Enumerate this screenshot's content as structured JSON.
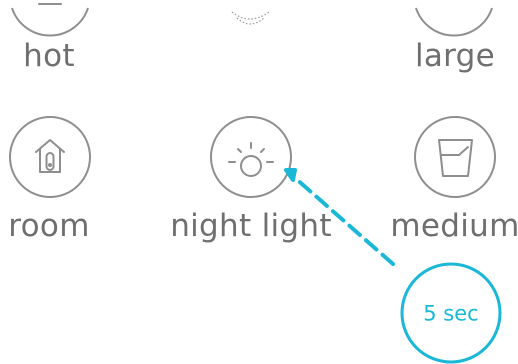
{
  "options": {
    "top_left": {
      "label": "hot",
      "icon": "dial-icon"
    },
    "top_center": {
      "label": "",
      "icon": "dimmed-sun-icon"
    },
    "top_right": {
      "label": "large",
      "icon": "cup-icon"
    },
    "room": {
      "label": "room",
      "icon": "house-thermometer-icon"
    },
    "night_light": {
      "label": "night light",
      "icon": "sun-icon"
    },
    "medium": {
      "label": "medium",
      "icon": "cup-icon"
    }
  },
  "timer": {
    "label": "5 sec",
    "color": "#1ab8d6"
  },
  "colors": {
    "icon_stroke": "#8e8e8e",
    "label_text": "#6f6f6f",
    "accent": "#1ab8d6"
  }
}
